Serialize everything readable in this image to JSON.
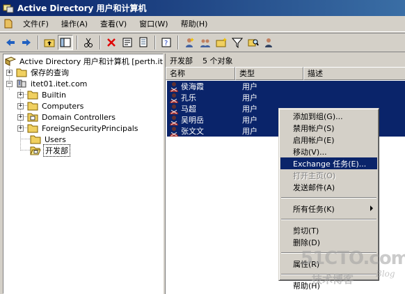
{
  "window": {
    "title": "Active Directory 用户和计算机"
  },
  "menu": [
    "文件(F)",
    "操作(A)",
    "查看(V)",
    "窗口(W)",
    "帮助(H)"
  ],
  "toolbar": {
    "icons": [
      "back-icon",
      "forward-icon",
      "up-folder-icon",
      "show-tree-icon",
      "cut-icon",
      "delete-icon",
      "properties-icon",
      "export-icon",
      "help-icon",
      "new-user-icon",
      "new-group-icon",
      "new-ou-icon",
      "filter-icon",
      "find-icon",
      "add-to-group-icon"
    ]
  },
  "tree": {
    "root": "Active Directory 用户和计算机 [perth.itet",
    "saved_queries": "保存的查询",
    "domain": "itet01.itet.com",
    "children": [
      "Builtin",
      "Computers",
      "Domain Controllers",
      "ForeignSecurityPrincipals",
      "Users",
      "开发部"
    ],
    "selected": "开发部"
  },
  "list": {
    "caption": "开发部",
    "count": "5 个对象",
    "columns": [
      "名称",
      "类型",
      "描述"
    ],
    "rows": [
      {
        "name": "侯海霞",
        "type": "用户"
      },
      {
        "name": "孔乐",
        "type": "用户"
      },
      {
        "name": "马超",
        "type": "用户"
      },
      {
        "name": "吴明岳",
        "type": "用户"
      },
      {
        "name": "张文文",
        "type": "用户"
      }
    ]
  },
  "context_menu": {
    "add_to_group": "添加到组(G)...",
    "disable_account": "禁用帐户(S)",
    "enable_account": "启用帐户(E)",
    "move": "移动(V)...",
    "exchange_tasks": "Exchange 任务(E)...",
    "open_home_page": "打开主页(O)",
    "send_mail": "发送邮件(A)",
    "all_tasks": "所有任务(K)",
    "cut": "剪切(T)",
    "delete": "删除(D)",
    "properties": "属性(R)",
    "help": "帮助(H)"
  },
  "watermark": {
    "site": "51CTO.com",
    "blog_cn": "技术博客",
    "blog_en": "Blog"
  },
  "colors": {
    "title_blue": "#0a246a",
    "selection": "#0a246a",
    "face": "#d4d0c8"
  }
}
